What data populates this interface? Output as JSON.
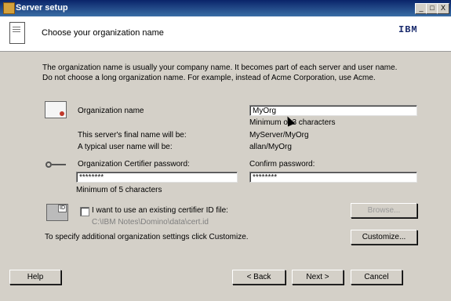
{
  "window": {
    "title": "Server setup",
    "minimize_label": "_",
    "maximize_label": "□",
    "close_label": "X"
  },
  "header": {
    "title": "Choose your organization name",
    "brand": "IBM"
  },
  "intro": {
    "line1": "The organization name is usually your company name. It becomes part of each server and user name.",
    "line2": "Do not choose a long organization name. For example, instead of Acme Corporation, use Acme."
  },
  "org": {
    "label": "Organization name",
    "value": "MyOrg",
    "hint": "Minimum of 3 characters",
    "server_label": "This server's final name will be:",
    "server_value": "MyServer/MyOrg",
    "user_label": "A typical user name will be:",
    "user_value": "allan/MyOrg"
  },
  "password": {
    "label": "Organization Certifier password:",
    "value": "********",
    "hint": "Minimum of 5 characters",
    "confirm_label": "Confirm password:",
    "confirm_value": "********"
  },
  "certifier": {
    "checkbox_label": "I want to use an existing certifier ID file:",
    "path": "C:\\IBM Notes\\Domino\\data\\cert.id",
    "browse_label": "Browse..."
  },
  "customize": {
    "text": "To specify additional organization settings click Customize.",
    "button_label": "Customize..."
  },
  "footer": {
    "help_label": "Help",
    "back_label": "< Back",
    "next_label": "Next >",
    "cancel_label": "Cancel"
  }
}
